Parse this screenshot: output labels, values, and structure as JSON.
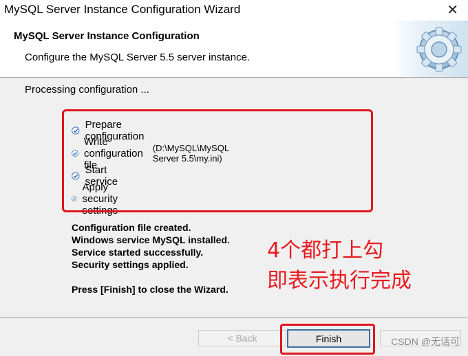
{
  "window": {
    "title": "MySQL Server Instance Configuration Wizard"
  },
  "header": {
    "title": "MySQL Server Instance Configuration",
    "subtitle": "Configure the MySQL Server 5.5 server instance."
  },
  "content": {
    "processing": "Processing configuration ...",
    "steps": [
      {
        "label": "Prepare configuration",
        "detail": ""
      },
      {
        "label": "Write configuration file",
        "detail": "(D:\\MySQL\\MySQL Server 5.5\\my.ini)"
      },
      {
        "label": "Start service",
        "detail": ""
      },
      {
        "label": "Apply security settings",
        "detail": ""
      }
    ],
    "results": [
      "Configuration file created.",
      "Windows service MySQL installed.",
      "Service started successfully.",
      "Security settings applied."
    ],
    "close_hint": "Press [Finish] to close the Wizard."
  },
  "annotation": {
    "line1": "4个都打上勾",
    "line2": "即表示执行完成",
    "color": "#e81a1f"
  },
  "footer": {
    "back_label": "< Back",
    "finish_label": "Finish",
    "watermark": "CSDN @无话可"
  }
}
